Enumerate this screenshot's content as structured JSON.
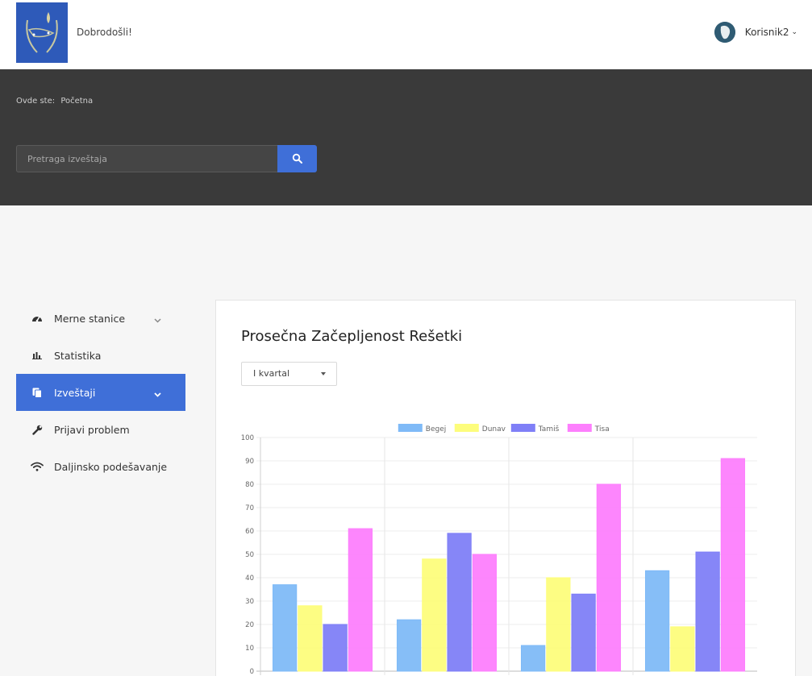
{
  "header": {
    "welcome": "Dobrodošli!",
    "username": "Korisnik2",
    "user_caret": "⌄"
  },
  "breadcrumb": {
    "label": "Ovde ste:",
    "current": "Početna"
  },
  "search": {
    "placeholder": "Pretraga izveštaja",
    "icon": "search-icon"
  },
  "sidebar": {
    "items": [
      {
        "label": "Merne stanice",
        "icon": "dashboard-icon",
        "has_chevron": true,
        "active": false
      },
      {
        "label": "Statistika",
        "icon": "bar-chart-icon",
        "has_chevron": false,
        "active": false
      },
      {
        "label": "Izveštaji",
        "icon": "copy-icon",
        "has_chevron": true,
        "active": true
      },
      {
        "label": "Prijavi problem",
        "icon": "wrench-icon",
        "has_chevron": false,
        "active": false
      },
      {
        "label": "Daljinsko podešavanje",
        "icon": "wifi-icon",
        "has_chevron": false,
        "active": false
      }
    ]
  },
  "report": {
    "title": "Prosečna Začepljenost Rešetki",
    "period_selected": "I kvartal"
  },
  "colors": {
    "accent": "#3f6fd8",
    "banner": "#3a3a3a"
  },
  "chart_data": {
    "type": "bar",
    "categories": [
      "",
      "",
      "",
      ""
    ],
    "series": [
      {
        "name": "Begej",
        "color": "#7fbaf7",
        "values": [
          37,
          22,
          11,
          43
        ]
      },
      {
        "name": "Dunav",
        "color": "#fdfd7c",
        "values": [
          28,
          48,
          40,
          19
        ]
      },
      {
        "name": "Tamiš",
        "color": "#7f7ff7",
        "values": [
          20,
          59,
          33,
          51
        ]
      },
      {
        "name": "Tisa",
        "color": "#fd7ffd",
        "values": [
          61,
          50,
          80,
          91
        ]
      }
    ],
    "ylim": [
      0,
      100
    ],
    "yticks": [
      "0",
      "10",
      "20",
      "30",
      "40",
      "50",
      "60",
      "70",
      "80",
      "90",
      "100"
    ],
    "grid": true,
    "legend": "top"
  }
}
